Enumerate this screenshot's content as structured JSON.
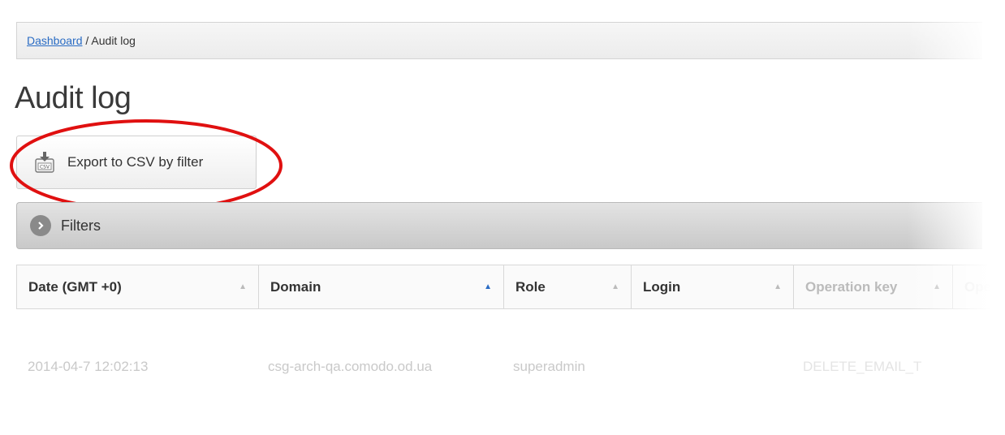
{
  "breadcrumb": {
    "link": "Dashboard",
    "separator": " / ",
    "current": "Audit log"
  },
  "page_title": "Audit log",
  "export_button": {
    "label": "Export to CSV by filter",
    "icon": "csv-export-icon"
  },
  "filters": {
    "label": "Filters",
    "icon": "chevron-right-icon"
  },
  "table": {
    "columns": [
      {
        "label": "Date (GMT +0)",
        "sort_active": false
      },
      {
        "label": "Domain",
        "sort_active": true
      },
      {
        "label": "Role",
        "sort_active": false
      },
      {
        "label": "Login",
        "sort_active": false
      },
      {
        "label": "Operation key",
        "sort_active": false
      },
      {
        "label": "Ope",
        "sort_active": false
      }
    ],
    "rows": [
      [
        "2014-04-7 12:02:13",
        "csg-arch-qa.comodo.od.ua",
        "superadmin",
        "",
        "DELETE_EMAIL_T"
      ]
    ]
  },
  "colors": {
    "link": "#2a6cc4",
    "highlight_ellipse": "#e01010",
    "sort_active": "#2a6cc4"
  }
}
